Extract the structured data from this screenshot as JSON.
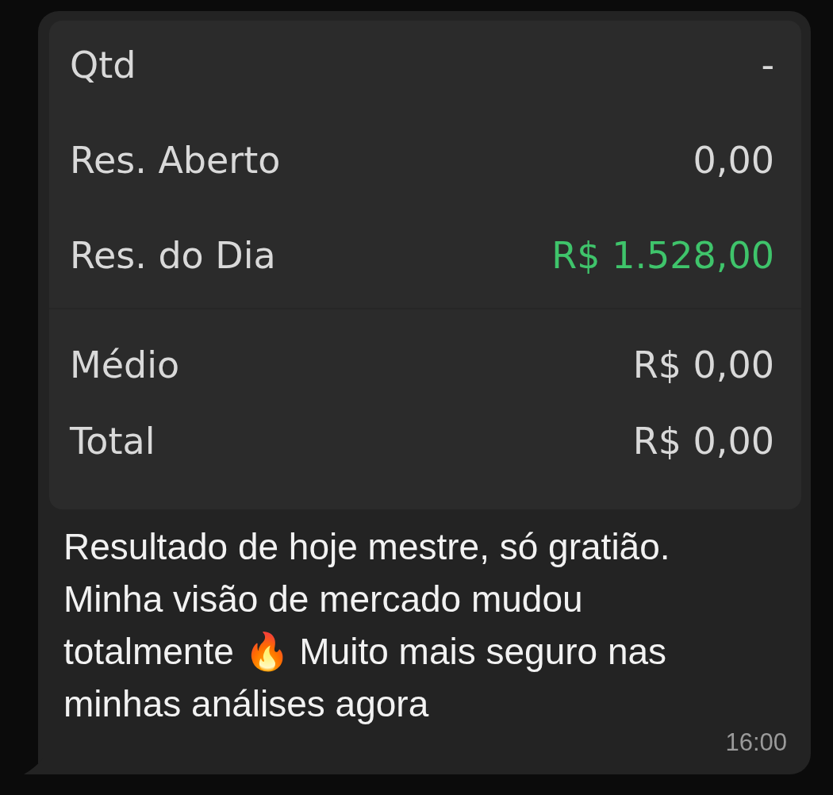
{
  "message": {
    "screenshot": {
      "sections": [
        {
          "rows": [
            {
              "label": "Qtd",
              "value": "-",
              "color": "#d9d9d9"
            },
            {
              "label": "Res. Aberto",
              "value": "0,00",
              "color": "#d9d9d9"
            },
            {
              "label": "Res. do Dia",
              "value": "R$ 1.528,00",
              "color": "#3fc46b"
            }
          ]
        },
        {
          "rows": [
            {
              "label": "Médio",
              "value": "R$ 0,00",
              "color": "#d9d9d9"
            },
            {
              "label": "Total",
              "value": "R$ 0,00",
              "color": "#d9d9d9"
            }
          ]
        }
      ]
    },
    "text": "Resultado de hoje mestre, só gratião. Minha visão de mercado mudou totalmente 🔥 Muito mais seguro nas minhas análises agora",
    "time": "16:00"
  }
}
